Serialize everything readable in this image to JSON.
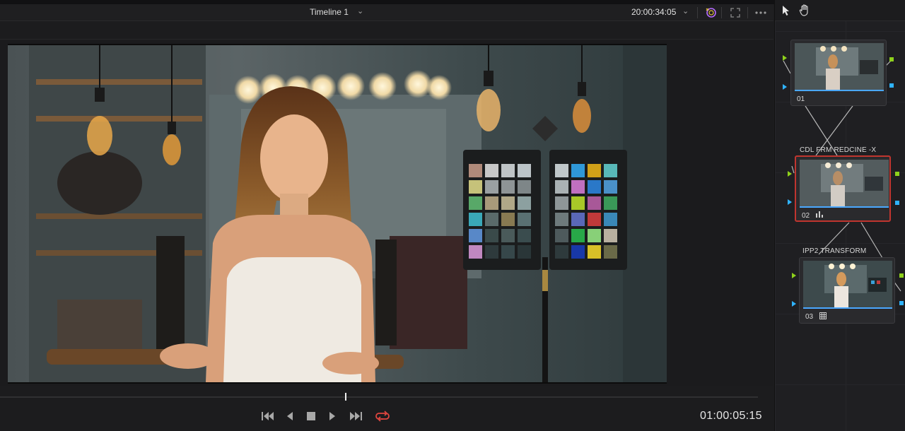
{
  "viewer": {
    "timeline_name": "Timeline 1",
    "source_timecode": "20:00:34:05",
    "record_timecode": "01:00:05:15",
    "playhead_fraction": 0.455
  },
  "icons": {
    "timeline_dropdown": "chevron-down-icon",
    "timecode_dropdown": "chevron-down-icon",
    "highlight": "highlight-icon",
    "fullscreen": "expand-icon",
    "options": "more-options-icon",
    "pointer_tool": "pointer-icon",
    "hand_tool": "hand-icon",
    "transport": [
      "skip-to-start-icon",
      "play-reverse-icon",
      "stop-icon",
      "play-icon",
      "skip-to-end-icon",
      "loop-icon"
    ]
  },
  "colors": {
    "accent_red": "#e0463f",
    "node_selected_border": "#c0352f",
    "rgb_port": "#8ed11b",
    "alpha_port": "#2fb3ff",
    "highlight_icon_ring": "#b56cff"
  },
  "nodes": [
    {
      "number": "01",
      "label": "",
      "tool_icon": ""
    },
    {
      "number": "02",
      "label": "CDL FRM REDCINE -X",
      "tool_icon": "bar-chart-icon",
      "selected": true
    },
    {
      "number": "03",
      "label": "IPP2 TRANSFORM",
      "tool_icon": "grid-icon"
    }
  ]
}
